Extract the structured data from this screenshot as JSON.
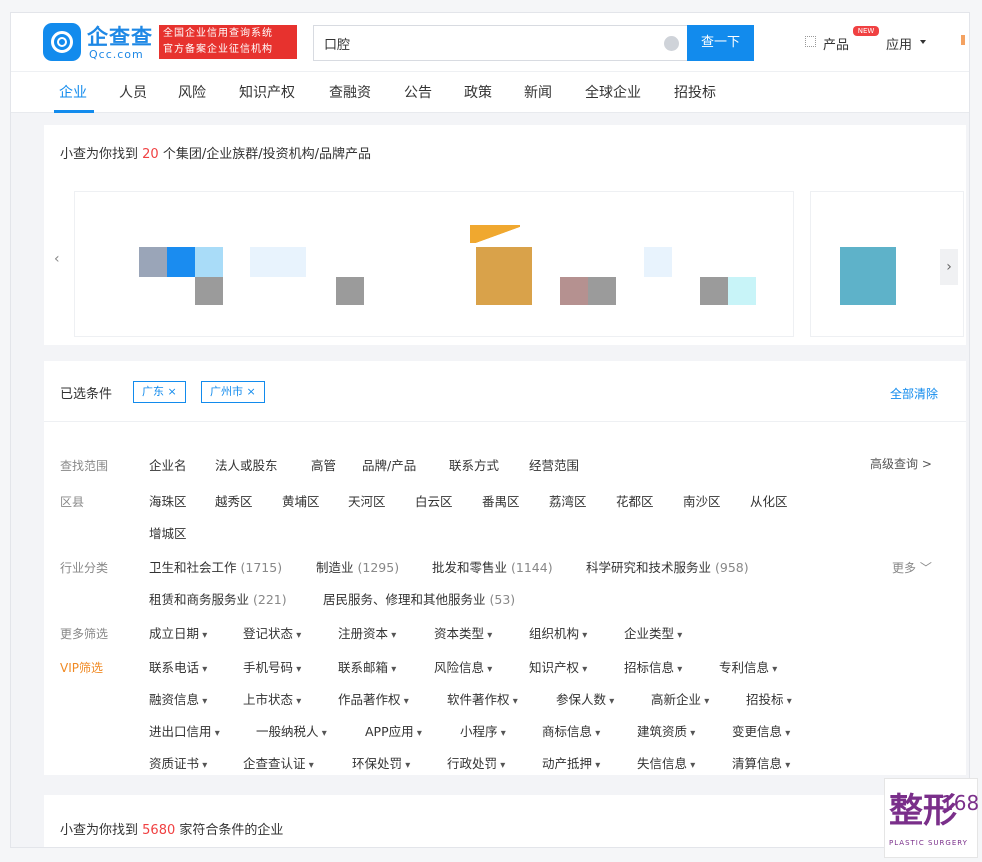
{
  "header": {
    "logo_cn": "企查查",
    "logo_en": "Qcc.com",
    "promo_line1": "全国企业信用查询系统",
    "promo_line2": "官方备案企业征信机构",
    "search_value": "口腔",
    "search_button": "查一下",
    "product_label": "产品",
    "product_badge": "NEW",
    "apps_label": "应用"
  },
  "tabs": [
    {
      "label": "企业",
      "active": true
    },
    {
      "label": "人员"
    },
    {
      "label": "风险"
    },
    {
      "label": "知识产权"
    },
    {
      "label": "查融资"
    },
    {
      "label": "公告"
    },
    {
      "label": "政策"
    },
    {
      "label": "新闻"
    },
    {
      "label": "全球企业"
    },
    {
      "label": "招投标"
    }
  ],
  "groups": {
    "heading_prefix": "小查为你找到",
    "heading_count": "20",
    "heading_suffix": "个集团/企业族群/投资机构/品牌产品",
    "prev_arrow": "‹",
    "next_arrow": "›",
    "colors": [
      "#9aa5b8",
      "#1a8cf0",
      "#a9dcf8",
      "#e8f3fd",
      "#9b9b9b",
      "#d9a24a",
      "#f0a82f",
      "#b59190",
      "#9b9b9b",
      "#e8f3fd",
      "#c8f4f8",
      "#5eb2c9"
    ]
  },
  "filters": {
    "selected_label": "已选条件",
    "chips": [
      "广东 ×",
      "广州市 ×"
    ],
    "clear_all": "全部清除",
    "scope": {
      "label": "查找范围",
      "options": [
        "企业名",
        "法人或股东",
        "高管",
        "品牌/产品",
        "联系方式",
        "经营范围"
      ],
      "advanced": "高级查询 >"
    },
    "district": {
      "label": "区县",
      "options": [
        "海珠区",
        "越秀区",
        "黄埔区",
        "天河区",
        "白云区",
        "番禺区",
        "荔湾区",
        "花都区",
        "南沙区",
        "从化区",
        "增城区"
      ]
    },
    "industry": {
      "label": "行业分类",
      "options": [
        {
          "name": "卫生和社会工作",
          "count": "(1715)"
        },
        {
          "name": "制造业",
          "count": "(1295)"
        },
        {
          "name": "批发和零售业",
          "count": "(1144)"
        },
        {
          "name": "科学研究和技术服务业",
          "count": "(958)"
        },
        {
          "name": "租赁和商务服务业",
          "count": "(221)"
        },
        {
          "name": "居民服务、修理和其他服务业",
          "count": "(53)"
        }
      ],
      "more": "更多 ﹀"
    },
    "more_filters": {
      "label": "更多筛选",
      "options": [
        "成立日期",
        "登记状态",
        "注册资本",
        "资本类型",
        "组织机构",
        "企业类型"
      ]
    },
    "vip_filters": {
      "label": "VIP筛选",
      "rows": [
        [
          "联系电话",
          "手机号码",
          "联系邮箱",
          "风险信息",
          "知识产权",
          "招标信息",
          "专利信息"
        ],
        [
          "融资信息",
          "上市状态",
          "作品著作权",
          "软件著作权",
          "参保人数",
          "高新企业",
          "招投标"
        ],
        [
          "进出口信用",
          "一般纳税人",
          "APP应用",
          "小程序",
          "商标信息",
          "建筑资质",
          "变更信息"
        ],
        [
          "资质证书",
          "企查查认证",
          "环保处罚",
          "行政处罚",
          "动产抵押",
          "失信信息",
          "清算信息"
        ]
      ]
    }
  },
  "results": {
    "prefix": "小查为你找到",
    "count": "5680",
    "suffix": "家符合条件的企业"
  },
  "watermark": {
    "glyph": "整形",
    "number": "168",
    "sub": "PLASTIC SURGERY"
  }
}
